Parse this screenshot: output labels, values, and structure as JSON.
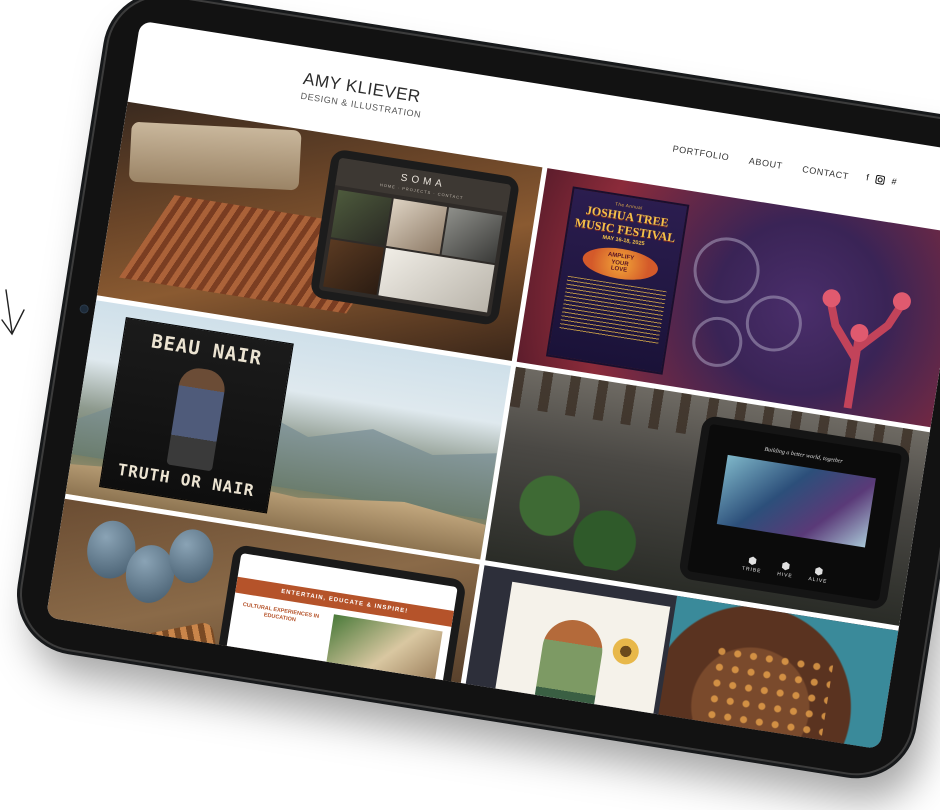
{
  "site": {
    "name": "AMY KLIEVER",
    "tagline": "DESIGN & ILLUSTRATION"
  },
  "nav": {
    "items": [
      "PORTFOLIO",
      "ABOUT",
      "CONTACT"
    ]
  },
  "social": {
    "facebook": "f",
    "instagram": "instagram-icon",
    "other": "#"
  },
  "portfolio": {
    "soma": {
      "logo": "SOMA",
      "nav": "HOME · PROJECTS · CONTACT"
    },
    "joshua_tree": {
      "top": "The Annual",
      "title_1": "JOSHUA TREE",
      "title_2": "MUSIC FESTIVAL",
      "dates": "MAY 16-18, 2025",
      "badge_1": "AMPLIFY",
      "badge_2": "YOUR",
      "badge_3": "LOVE"
    },
    "beau_nair": {
      "title": "BEAU NAIR",
      "subtitle": "TRUTH OR NAIR"
    },
    "tribe": {
      "tagline": "Building a better world, together",
      "icons": [
        "TRIBE",
        "HIVE",
        "ALIVE"
      ]
    },
    "education": {
      "banner": "ENTERTAIN, EDUCATE & INSPIRE!",
      "callout": "CULTURAL EXPERIENCES IN EDUCATION"
    }
  },
  "colors": {
    "device": "#121212",
    "accent_education": "#b5532a",
    "poster_gold": "#f2c14a"
  }
}
